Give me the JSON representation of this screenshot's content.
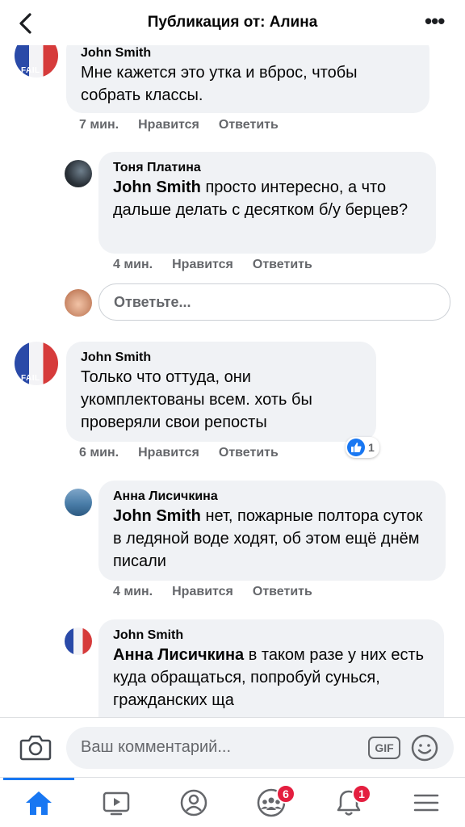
{
  "header": {
    "title": "Публикация от: Алина"
  },
  "comments": [
    {
      "author": "John Smith",
      "text": "Мне кажется это утка и вброс, чтобы собрать классы.",
      "time": "7 мин.",
      "like_label": "Нравится",
      "reply_label": "Ответить"
    },
    {
      "author": "Тоня Платина",
      "mention": "John Smith",
      "text": " просто интересно, а что дальше делать с десятком б/у берцев?",
      "time": "4 мин.",
      "like_label": "Нравится",
      "reply_label": "Ответить"
    },
    {
      "author": "John Smith",
      "text": "Только что оттуда, они укомплектованы всем. хоть бы проверяли свои репосты",
      "time": "6 мин.",
      "like_label": "Нравится",
      "reply_label": "Ответить",
      "reaction_count": "1"
    },
    {
      "author": "Анна Лисичкина",
      "mention": "John Smith",
      "text": " нет, пожарные полтора суток в ледяной воде ходят, об этом ещё днём писали",
      "time": "4 мин.",
      "like_label": "Нравится",
      "reply_label": "Ответить"
    },
    {
      "author": "John Smith",
      "mention": "Анна Лисичкина",
      "text": " в таком разе у них есть куда обращаться, попробуй сунься, гражданских ща"
    }
  ],
  "reply_box": {
    "placeholder": "Ответьте..."
  },
  "composer": {
    "placeholder": "Ваш комментарий...",
    "gif_label": "GIF"
  },
  "tabbar": {
    "groups_badge": "6",
    "notifications_badge": "1"
  },
  "colors": {
    "accent": "#1877f2",
    "badge": "#e41e3f",
    "bubble": "#f0f2f5",
    "meta_text": "#65676b"
  }
}
